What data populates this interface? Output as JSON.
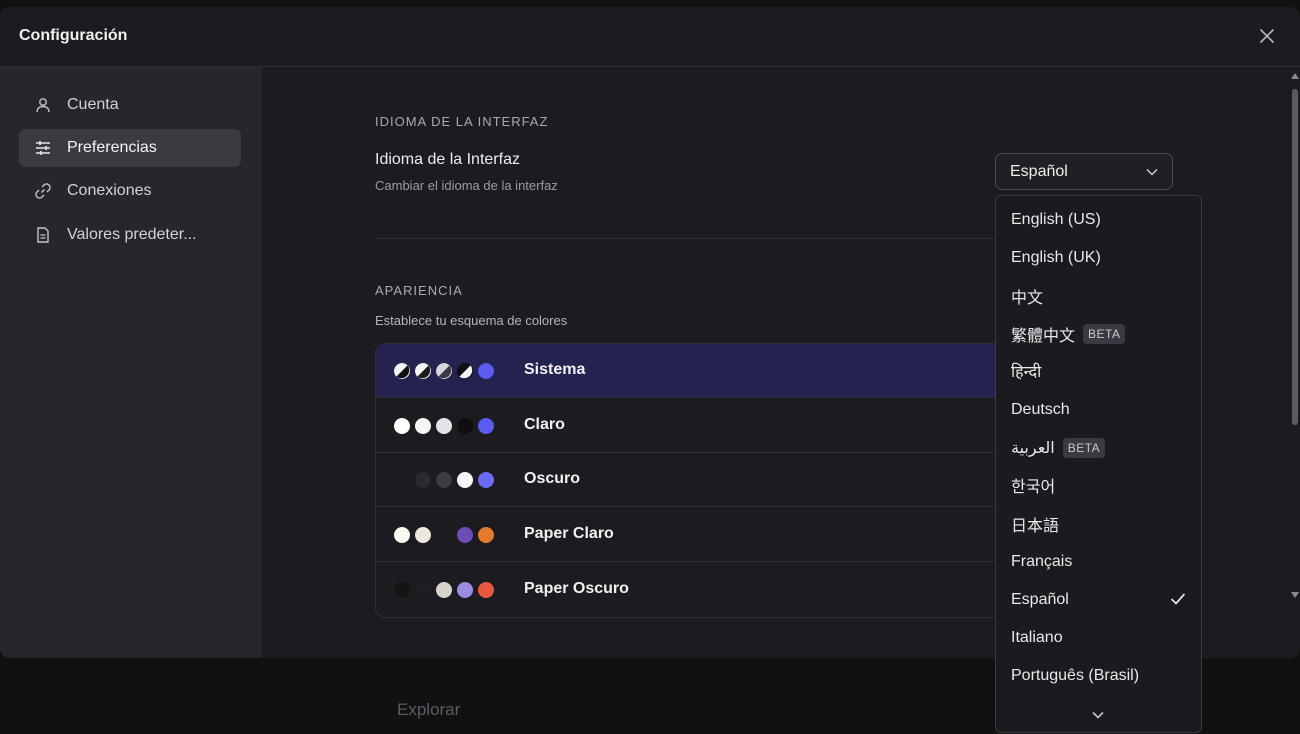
{
  "background": {
    "explore_label": "Explorar"
  },
  "modal": {
    "title": "Configuración",
    "close_icon": "close-icon"
  },
  "sidebar": {
    "items": [
      {
        "label": "Cuenta",
        "icon": "user-icon",
        "active": false
      },
      {
        "label": "Preferencias",
        "icon": "sliders-icon",
        "active": true
      },
      {
        "label": "Conexiones",
        "icon": "link-icon",
        "active": false
      },
      {
        "label": "Valores predeter...",
        "icon": "document-icon",
        "active": false
      }
    ]
  },
  "language": {
    "section_label": "IDIOMA DE LA INTERFAZ",
    "title": "Idioma de la Interfaz",
    "description": "Cambiar el idioma de la interfaz",
    "selected": "Español",
    "options": [
      {
        "label": "English (US)"
      },
      {
        "label": "English (UK)"
      },
      {
        "label": "中文"
      },
      {
        "label": "繁體中文",
        "badge": "BETA"
      },
      {
        "label": "हिन्दी"
      },
      {
        "label": "Deutsch"
      },
      {
        "label": "العربية",
        "badge": "BETA"
      },
      {
        "label": "한국어"
      },
      {
        "label": "日本語"
      },
      {
        "label": "Français"
      },
      {
        "label": "Español",
        "checked": true
      },
      {
        "label": "Italiano"
      },
      {
        "label": "Português (Brasil)"
      }
    ]
  },
  "appearance": {
    "section_label": "APARIENCIA",
    "description": "Establece tu esquema de colores",
    "themes": [
      {
        "name": "Sistema",
        "selected": true,
        "swatches": [
          "half",
          "half",
          "half-gray",
          "half",
          "#5b5bef"
        ]
      },
      {
        "name": "Claro",
        "selected": false,
        "swatches": [
          "#ffffff",
          "#f4f4f6",
          "#e4e4e8",
          "#0f0f12",
          "#5b5bef"
        ]
      },
      {
        "name": "Oscuro",
        "selected": false,
        "swatches": [
          "#1c1c20",
          "#2a2a30",
          "#3c3c44",
          "#f5f5f7",
          "#6b6bf5"
        ]
      },
      {
        "name": "Paper Claro",
        "selected": false,
        "swatches": [
          "#fbf8ef",
          "#ece8df",
          "#1c1c20",
          "#6e4bb8",
          "#e57a2c"
        ]
      },
      {
        "name": "Paper Oscuro",
        "selected": false,
        "swatches": [
          "#141417",
          "#1e1e22",
          "#d8d4cc",
          "#9a8ce0",
          "#e8573f"
        ]
      }
    ]
  }
}
